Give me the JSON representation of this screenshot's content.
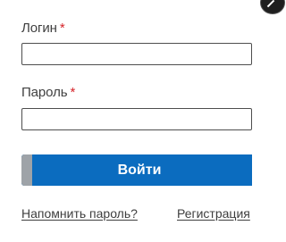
{
  "form": {
    "login": {
      "label": "Логин",
      "required_mark": "*",
      "value": "",
      "placeholder": ""
    },
    "password": {
      "label": "Пароль",
      "required_mark": "*",
      "value": "",
      "placeholder": ""
    },
    "submit_label": "Войти",
    "remind_password_link": "Напомнить пароль?",
    "register_link": "Регистрация"
  },
  "icons": {
    "corner": "close-icon"
  },
  "colors": {
    "accent": "#0b6cbf",
    "required": "#d6242a",
    "button_edge": "#9ea3a8",
    "text": "#404040"
  }
}
